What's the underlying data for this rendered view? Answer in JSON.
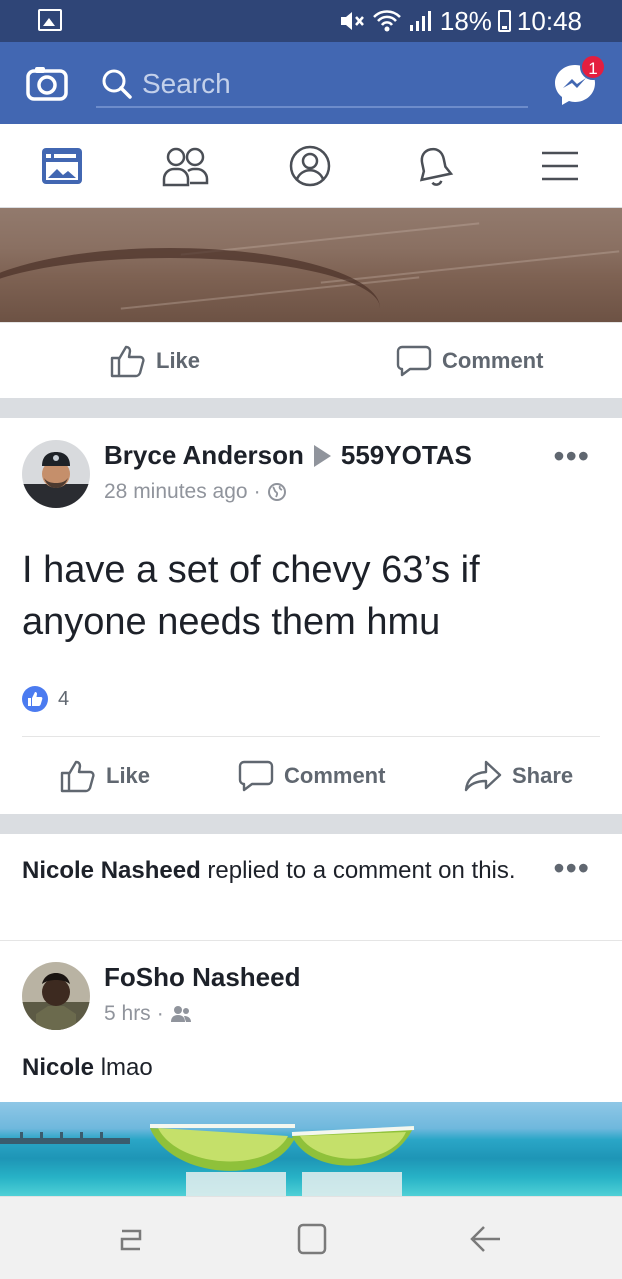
{
  "status_bar": {
    "battery": "18%",
    "time": "10:48"
  },
  "header": {
    "search_placeholder": "Search",
    "messenger_badge": "1"
  },
  "tabs": [
    {
      "name": "news-feed",
      "active": true
    },
    {
      "name": "friends"
    },
    {
      "name": "profile"
    },
    {
      "name": "notifications"
    },
    {
      "name": "menu"
    }
  ],
  "post1": {
    "like_label": "Like",
    "comment_label": "Comment"
  },
  "post2": {
    "author": "Bryce Anderson",
    "group": "559YOTAS",
    "time": "28 minutes ago",
    "separator": "·",
    "text": "I have a set of chevy 63’s if anyone needs them hmu",
    "like_count": "4",
    "like_label": "Like",
    "comment_label": "Comment",
    "share_label": "Share"
  },
  "post3": {
    "activity_name": "Nicole Nasheed",
    "activity_text": " replied to a comment on this.",
    "author": "FoSho Nasheed",
    "time": "5 hrs",
    "separator": "·",
    "comment_name": "Nicole",
    "comment_text": " lmao"
  },
  "colors": {
    "brand_blue": "#4267b2",
    "status_bar": "#2f4577",
    "badge_red": "#e41e3f",
    "meta_gray": "#90949c"
  }
}
